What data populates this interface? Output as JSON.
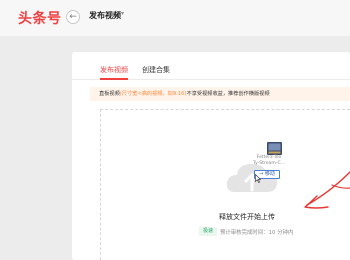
{
  "header": {
    "logo": "头条号",
    "back_icon": "arrow-left-icon",
    "title": "发布视频",
    "title_caret": "▾"
  },
  "tabs": [
    {
      "label": "发布视频",
      "active": true
    },
    {
      "label": "创建合集",
      "active": false
    }
  ],
  "notice": {
    "highlight": "直板视频",
    "muted": "(尺寸宽<高的视频，如9:16)",
    "rest": "不享受视频收益，推荐创作横版视频"
  },
  "dragged_file": {
    "name_line1": "Fetterz-Teo",
    "name_line2": "Ty-Stream-C...",
    "action_badge": "→ 移动"
  },
  "upload": {
    "hint": "释放文件开始上传",
    "review_badge": "极速",
    "review_text": "预计审核完成时间：10 分钟内"
  },
  "colors": {
    "brand_red": "#f04142",
    "annotation_red": "#e53935",
    "notice_bg": "#fff3ea",
    "notice_orange": "#ff8a3d",
    "success_green": "#2fa86b"
  }
}
